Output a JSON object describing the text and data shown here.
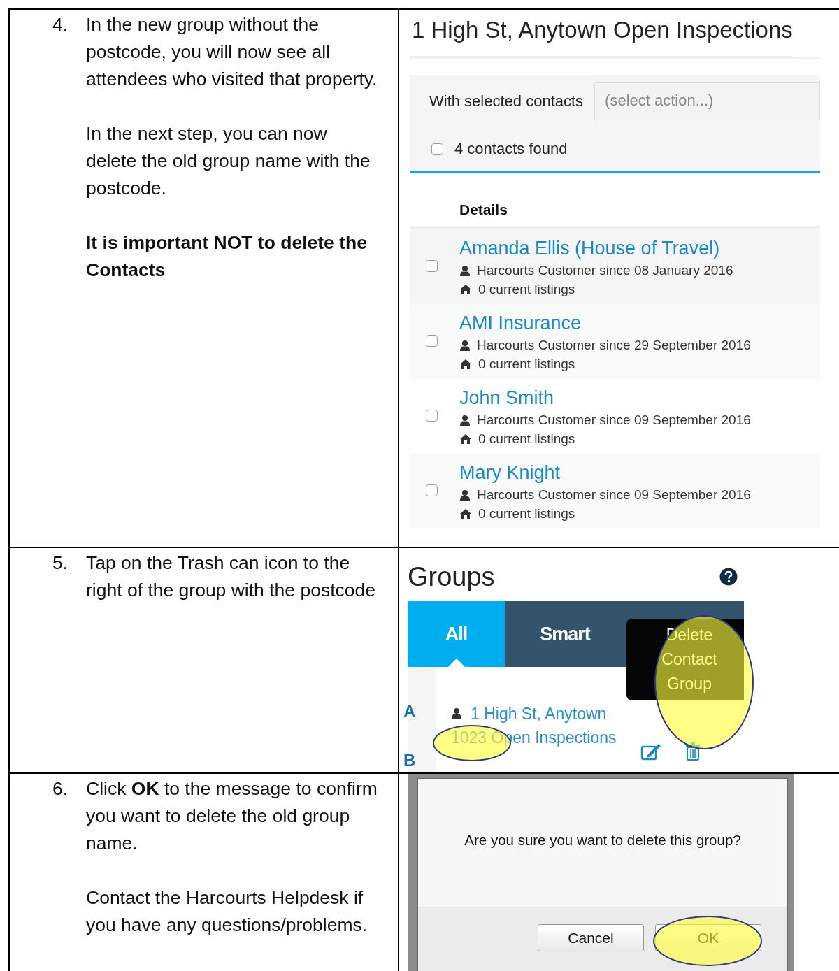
{
  "steps": [
    {
      "number": "4.",
      "paragraphs": [
        {
          "text": "In the new group without the postcode, you will now see all attendees who visited that property.",
          "bold": false
        },
        {
          "text": "In the next step, you can now delete the old group name with the postcode.",
          "bold": false
        },
        {
          "text": "It is important NOT to delete the Contacts",
          "bold": true
        }
      ],
      "screen": {
        "kind": "contacts",
        "title": "1 High St, Anytown Open Inspections",
        "action_label": "With selected contacts",
        "action_select": {
          "placeholder": "(select action...)"
        },
        "select_all": {
          "label": "4 contacts found",
          "checked": false
        },
        "column_header": "Details",
        "contacts": [
          {
            "name": "Amanda Ellis (House of Travel)",
            "customer_since": "Harcourts Customer since 08 January 2016",
            "listings": "0 current listings",
            "checked": false
          },
          {
            "name": "AMI Insurance",
            "customer_since": "Harcourts Customer since 29 September 2016",
            "listings": "0 current listings",
            "checked": false
          },
          {
            "name": "John Smith",
            "customer_since": "Harcourts Customer since 09 September 2016",
            "listings": "0 current listings",
            "checked": false
          },
          {
            "name": "Mary Knight",
            "customer_since": "Harcourts Customer since 09 September 2016",
            "listings": "0 current listings",
            "checked": false
          }
        ]
      }
    },
    {
      "number": "5.",
      "paragraphs": [
        {
          "text": "Tap on the Trash can icon to the right of the group with the postcode",
          "bold": false
        }
      ],
      "screen": {
        "kind": "groups",
        "title": "Groups",
        "tabs": [
          {
            "label": "All",
            "selected": true
          },
          {
            "label": "Smart",
            "selected": false
          }
        ],
        "tooltip": {
          "text": "Delete Contact Group",
          "highlighted": true
        },
        "index_letters": [
          "A",
          "B"
        ],
        "group": {
          "name": "1 High St, Anytown",
          "detail": "1023 Open Inspections",
          "detail_highlighted": true
        }
      }
    },
    {
      "number": "6.",
      "paragraphs": [
        {
          "text": "Click **OK** to the message to confirm you want to delete the old group name.",
          "bold": false
        },
        {
          "text": "Contact the Harcourts Helpdesk if you have any questions/problems.",
          "bold": false
        }
      ],
      "screen": {
        "kind": "confirm",
        "message": "Are you sure you want to delete this group?",
        "buttons": [
          {
            "label": "Cancel",
            "highlighted": false
          },
          {
            "label": "OK",
            "highlighted": true
          }
        ]
      }
    }
  ]
}
